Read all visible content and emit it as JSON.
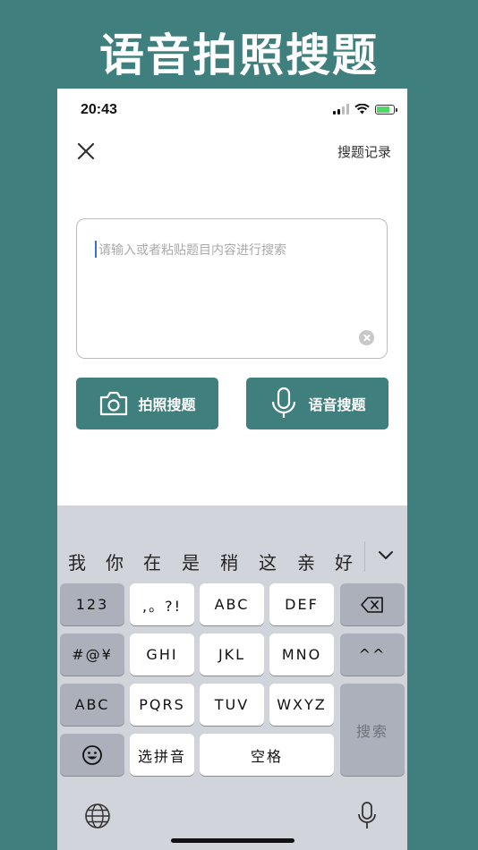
{
  "promo": {
    "title": "语音拍照搜题"
  },
  "status": {
    "time": "20:43"
  },
  "nav": {
    "history_label": "搜题记录"
  },
  "search": {
    "placeholder": "请输入或者粘贴题目内容进行搜索"
  },
  "actions": {
    "photo_label": "拍照搜题",
    "voice_label": "语音搜题"
  },
  "keyboard": {
    "candidates": [
      "我",
      "你",
      "在",
      "是",
      "稍",
      "这",
      "亲",
      "好"
    ],
    "keys": {
      "num": "123",
      "punct": ",。?!",
      "abc": "ABC",
      "def": "DEF",
      "symbols": "#@¥",
      "ghi": "GHI",
      "jkl": "JKL",
      "mno": "MNO",
      "emoticon": "^^",
      "abc_mode": "ABC",
      "pqrs": "PQRS",
      "tuv": "TUV",
      "wxyz": "WXYZ",
      "search": "搜索",
      "pinyin": "选拼音",
      "space": "空格"
    }
  },
  "colors": {
    "accent": "#3f7f7d",
    "keyboard_bg": "#d2d4db"
  }
}
